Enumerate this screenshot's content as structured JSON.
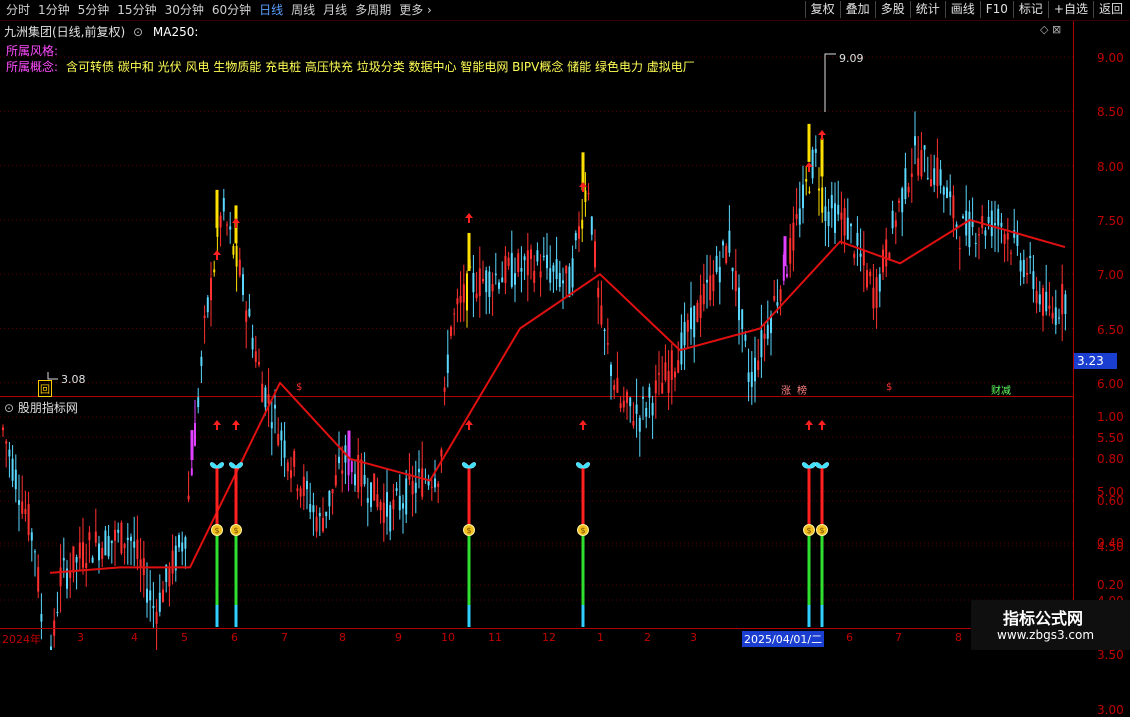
{
  "toolbar": {
    "periods": [
      "分时",
      "1分钟",
      "5分钟",
      "15分钟",
      "30分钟",
      "60分钟",
      "日线",
      "周线",
      "月线",
      "多周期",
      "更多"
    ],
    "active_period": "日线",
    "more_chevron_icon": "chevron-right-icon",
    "right_buttons": [
      "复权",
      "叠加",
      "多股",
      "统计",
      "画线",
      "F10",
      "标记",
      "+自选",
      "返回"
    ]
  },
  "header": {
    "stock_title": "九洲集团(日线,前复权)",
    "ma_label": "MA250:",
    "style_label": "所属风格:",
    "concept_label": "所属概念:",
    "concepts": "含可转债 碳中和 光伏 风电 生物质能 充电桩 高压快充 垃圾分类 数据中心 智能电网 BIPV概念 储能 绿色电力 虚拟电厂",
    "corner_icons": "◇ ⊠"
  },
  "main_chart": {
    "high_label": "9.09",
    "low_label": "3.08",
    "current_price": "3.23",
    "y_ticks": [
      "9.00",
      "8.50",
      "8.00",
      "7.50",
      "7.00",
      "6.50",
      "6.00",
      "5.50",
      "5.00",
      "4.50",
      "4.00",
      "3.50",
      "3.00"
    ],
    "event_marks": [
      {
        "text": "回",
        "color": "#ffcc00"
      },
      {
        "text": "$",
        "color": "#ff3030"
      },
      {
        "text": "涨",
        "color": "#ff8080"
      },
      {
        "text": "榜",
        "color": "#ff8080"
      },
      {
        "text": "$",
        "color": "#ff3030"
      },
      {
        "text": "财",
        "color": "#60ff60"
      },
      {
        "text": "减",
        "color": "#60ff60"
      }
    ],
    "colors": {
      "up": "#ff3030",
      "down": "#5ad8ff",
      "ma": "#e01010",
      "yellow": "#ffe000",
      "magenta": "#e040ff"
    }
  },
  "sub_chart": {
    "title": "股朋指标网",
    "y_ticks": [
      "1.00",
      "0.80",
      "0.60",
      "0.40",
      "0.20"
    ],
    "signal_icons": [
      "up-arrow-icon",
      "butterfly-icon",
      "money-bag-icon"
    ]
  },
  "x_axis": {
    "labels": [
      "2024年",
      "3",
      "4",
      "5",
      "6",
      "7",
      "8",
      "9",
      "10",
      "11",
      "12",
      "1",
      "2",
      "3",
      "2025/04/01/二",
      "6",
      "7",
      "8"
    ],
    "highlight": "2025/04/01/二"
  },
  "watermark": {
    "title": "指标公式网",
    "url": "www.zbgs3.com"
  },
  "chart_data": {
    "type": "candlestick",
    "price_range": [
      3.0,
      9.3
    ],
    "series": [
      {
        "name": "MA250",
        "anchors_x": [
          50,
          120,
          190,
          280,
          350,
          430,
          520,
          600,
          680,
          760,
          840,
          900,
          970,
          1065
        ],
        "anchors_y": [
          4.25,
          4.3,
          4.3,
          6.0,
          5.3,
          5.1,
          6.5,
          7.0,
          6.3,
          6.5,
          7.3,
          7.1,
          7.5,
          7.25
        ]
      }
    ],
    "signal_dates_x": [
      217,
      236,
      469,
      583,
      809,
      822
    ]
  }
}
